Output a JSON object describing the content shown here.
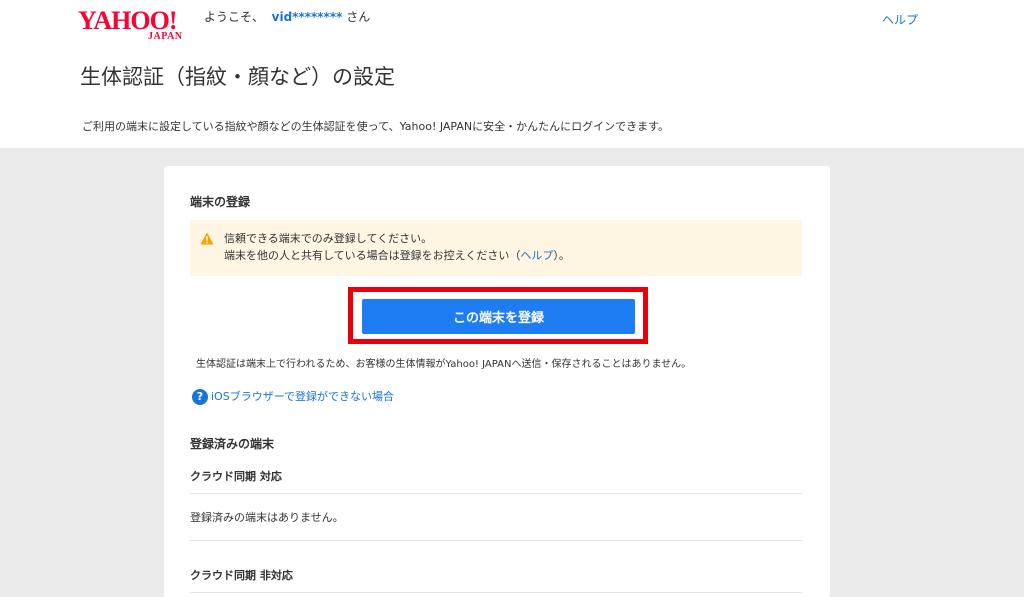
{
  "header": {
    "logo_main": "YAHOO!",
    "logo_sub": "JAPAN",
    "welcome_prefix": "ようこそ、",
    "user_id": "vid********",
    "welcome_suffix": "さん",
    "help_link": "ヘルプ",
    "page_title": "生体認証（指紋・顔など）の設定",
    "page_description": "ご利用の端末に設定している指紋や顔などの生体認証を使って、Yahoo! JAPANに安全・かんたんにログインできます。"
  },
  "registration": {
    "section_title": "端末の登録",
    "notice_line1": "信頼できる端末でのみ登録してください。",
    "notice_line2_prefix": "端末を他の人と共有している場合は登録をお控えください（",
    "notice_line2_link": "ヘルプ",
    "notice_line2_suffix": "）。",
    "register_button": "この端末を登録",
    "biometric_note": "生体認証は端末上で行われるため、お客様の生体情報がYahoo! JAPANへ送信・保存されることはありません。",
    "ios_help_link": "iOSブラウザーで登録ができない場合"
  },
  "registered": {
    "section_title": "登録済みの端末",
    "cloud_sync_supported": "クラウド同期 対応",
    "empty_message": "登録済みの端末はありません。",
    "cloud_sync_unsupported": "クラウド同期 非対応"
  },
  "icons": {
    "warning": "warning-icon",
    "help": "question-icon"
  },
  "colors": {
    "brand": "#ff0033",
    "link": "#1a73d8",
    "button": "#1e7df2",
    "highlight": "#e8000b",
    "notice_bg": "#fff5e3",
    "page_bg": "#ebebeb"
  }
}
